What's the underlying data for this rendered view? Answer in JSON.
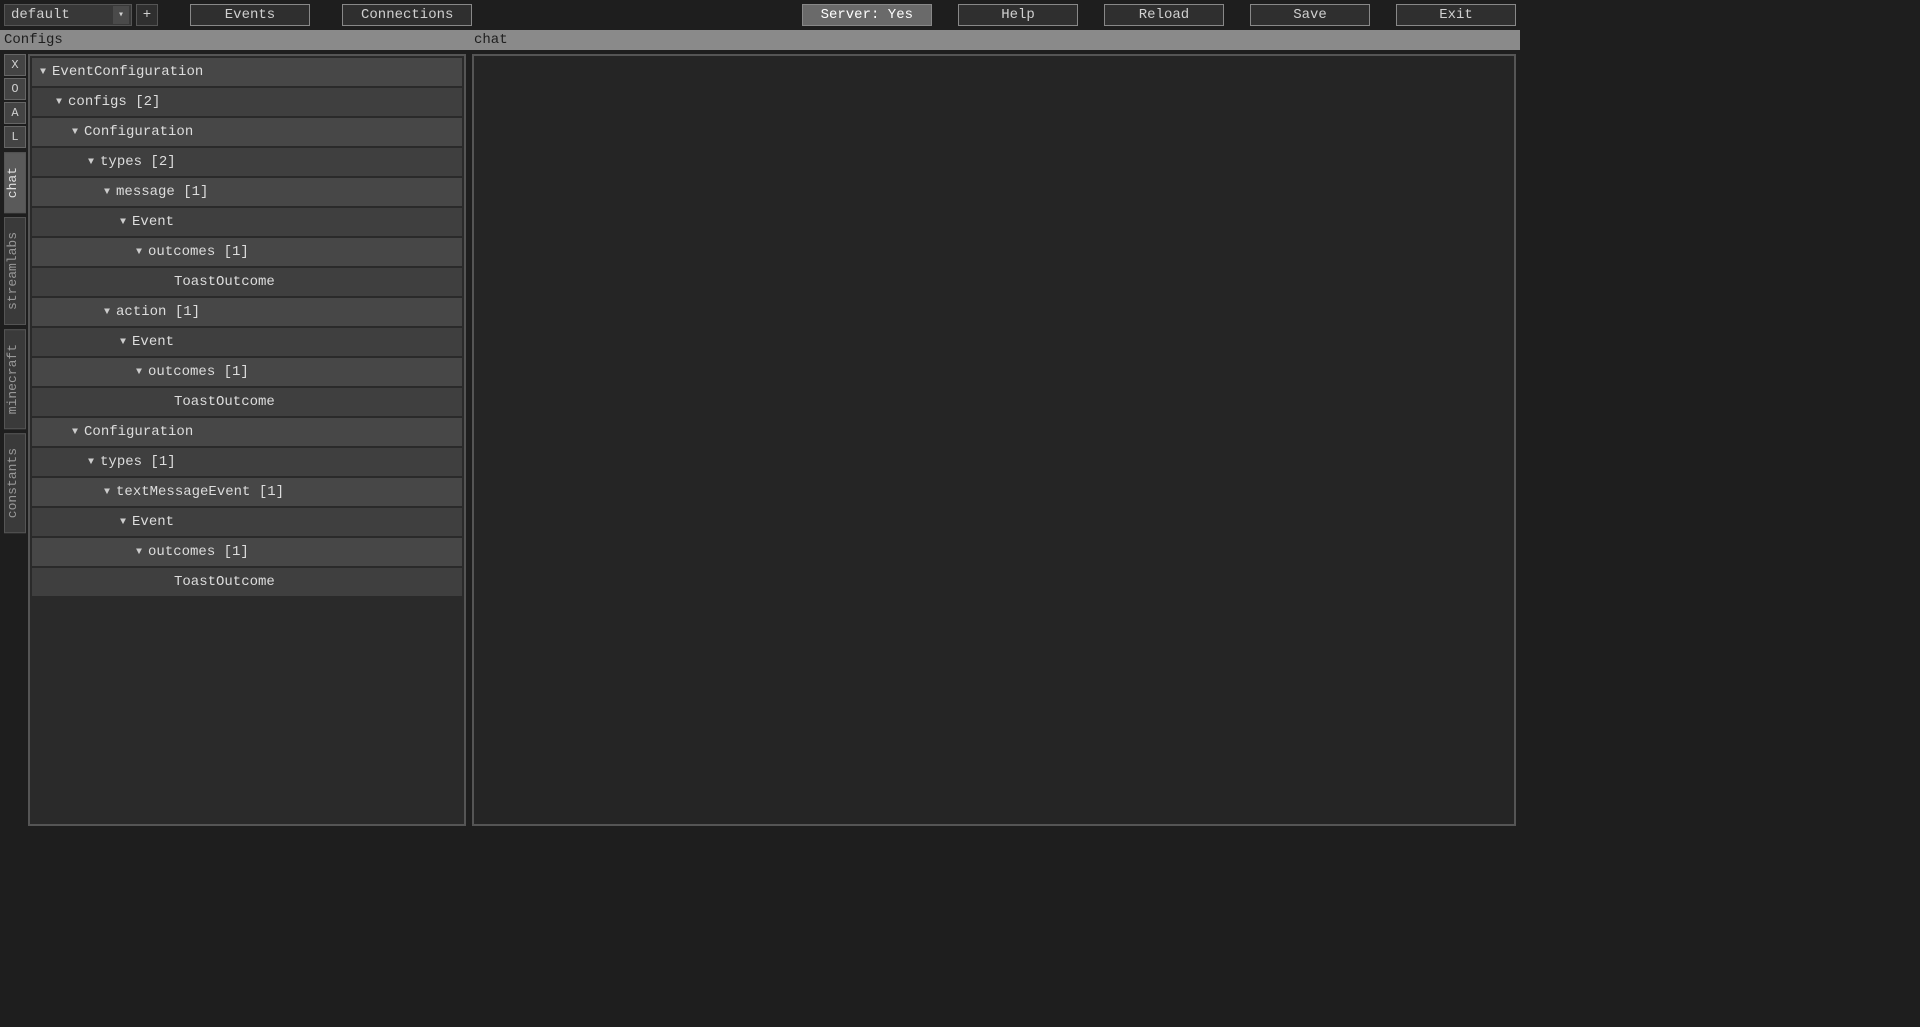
{
  "toolbar": {
    "dropdown_value": "default",
    "add_btn": "+",
    "events_btn": "Events",
    "connections_btn": "Connections",
    "server_btn": "Server: Yes",
    "help_btn": "Help",
    "reload_btn": "Reload",
    "save_btn": "Save",
    "exit_btn": "Exit"
  },
  "panels": {
    "left_title": "Configs",
    "right_title": "chat"
  },
  "side_letters": [
    "X",
    "O",
    "A",
    "L"
  ],
  "side_tabs": [
    {
      "label": "chat",
      "active": true
    },
    {
      "label": "streamlabs",
      "active": false
    },
    {
      "label": "minecraft",
      "active": false
    },
    {
      "label": "constants",
      "active": false
    }
  ],
  "tree": [
    {
      "label": "EventConfiguration",
      "indent": 0,
      "arrow": true,
      "alt": true
    },
    {
      "label": "configs [2]",
      "indent": 1,
      "arrow": true,
      "alt": false
    },
    {
      "label": "Configuration",
      "indent": 2,
      "arrow": true,
      "alt": true
    },
    {
      "label": "types [2]",
      "indent": 3,
      "arrow": true,
      "alt": false
    },
    {
      "label": "message [1]",
      "indent": 4,
      "arrow": true,
      "alt": true
    },
    {
      "label": "Event",
      "indent": 5,
      "arrow": true,
      "alt": false
    },
    {
      "label": "outcomes [1]",
      "indent": 6,
      "arrow": true,
      "alt": true
    },
    {
      "label": "ToastOutcome",
      "indent": 7,
      "arrow": false,
      "alt": false
    },
    {
      "label": "action [1]",
      "indent": 4,
      "arrow": true,
      "alt": true
    },
    {
      "label": "Event",
      "indent": 5,
      "arrow": true,
      "alt": false
    },
    {
      "label": "outcomes [1]",
      "indent": 6,
      "arrow": true,
      "alt": true
    },
    {
      "label": "ToastOutcome",
      "indent": 7,
      "arrow": false,
      "alt": false
    },
    {
      "label": "Configuration",
      "indent": 2,
      "arrow": true,
      "alt": true
    },
    {
      "label": "types [1]",
      "indent": 3,
      "arrow": true,
      "alt": false
    },
    {
      "label": "textMessageEvent [1]",
      "indent": 4,
      "arrow": true,
      "alt": true
    },
    {
      "label": "Event",
      "indent": 5,
      "arrow": true,
      "alt": false
    },
    {
      "label": "outcomes [1]",
      "indent": 6,
      "arrow": true,
      "alt": true
    },
    {
      "label": "ToastOutcome",
      "indent": 7,
      "arrow": false,
      "alt": false
    }
  ]
}
